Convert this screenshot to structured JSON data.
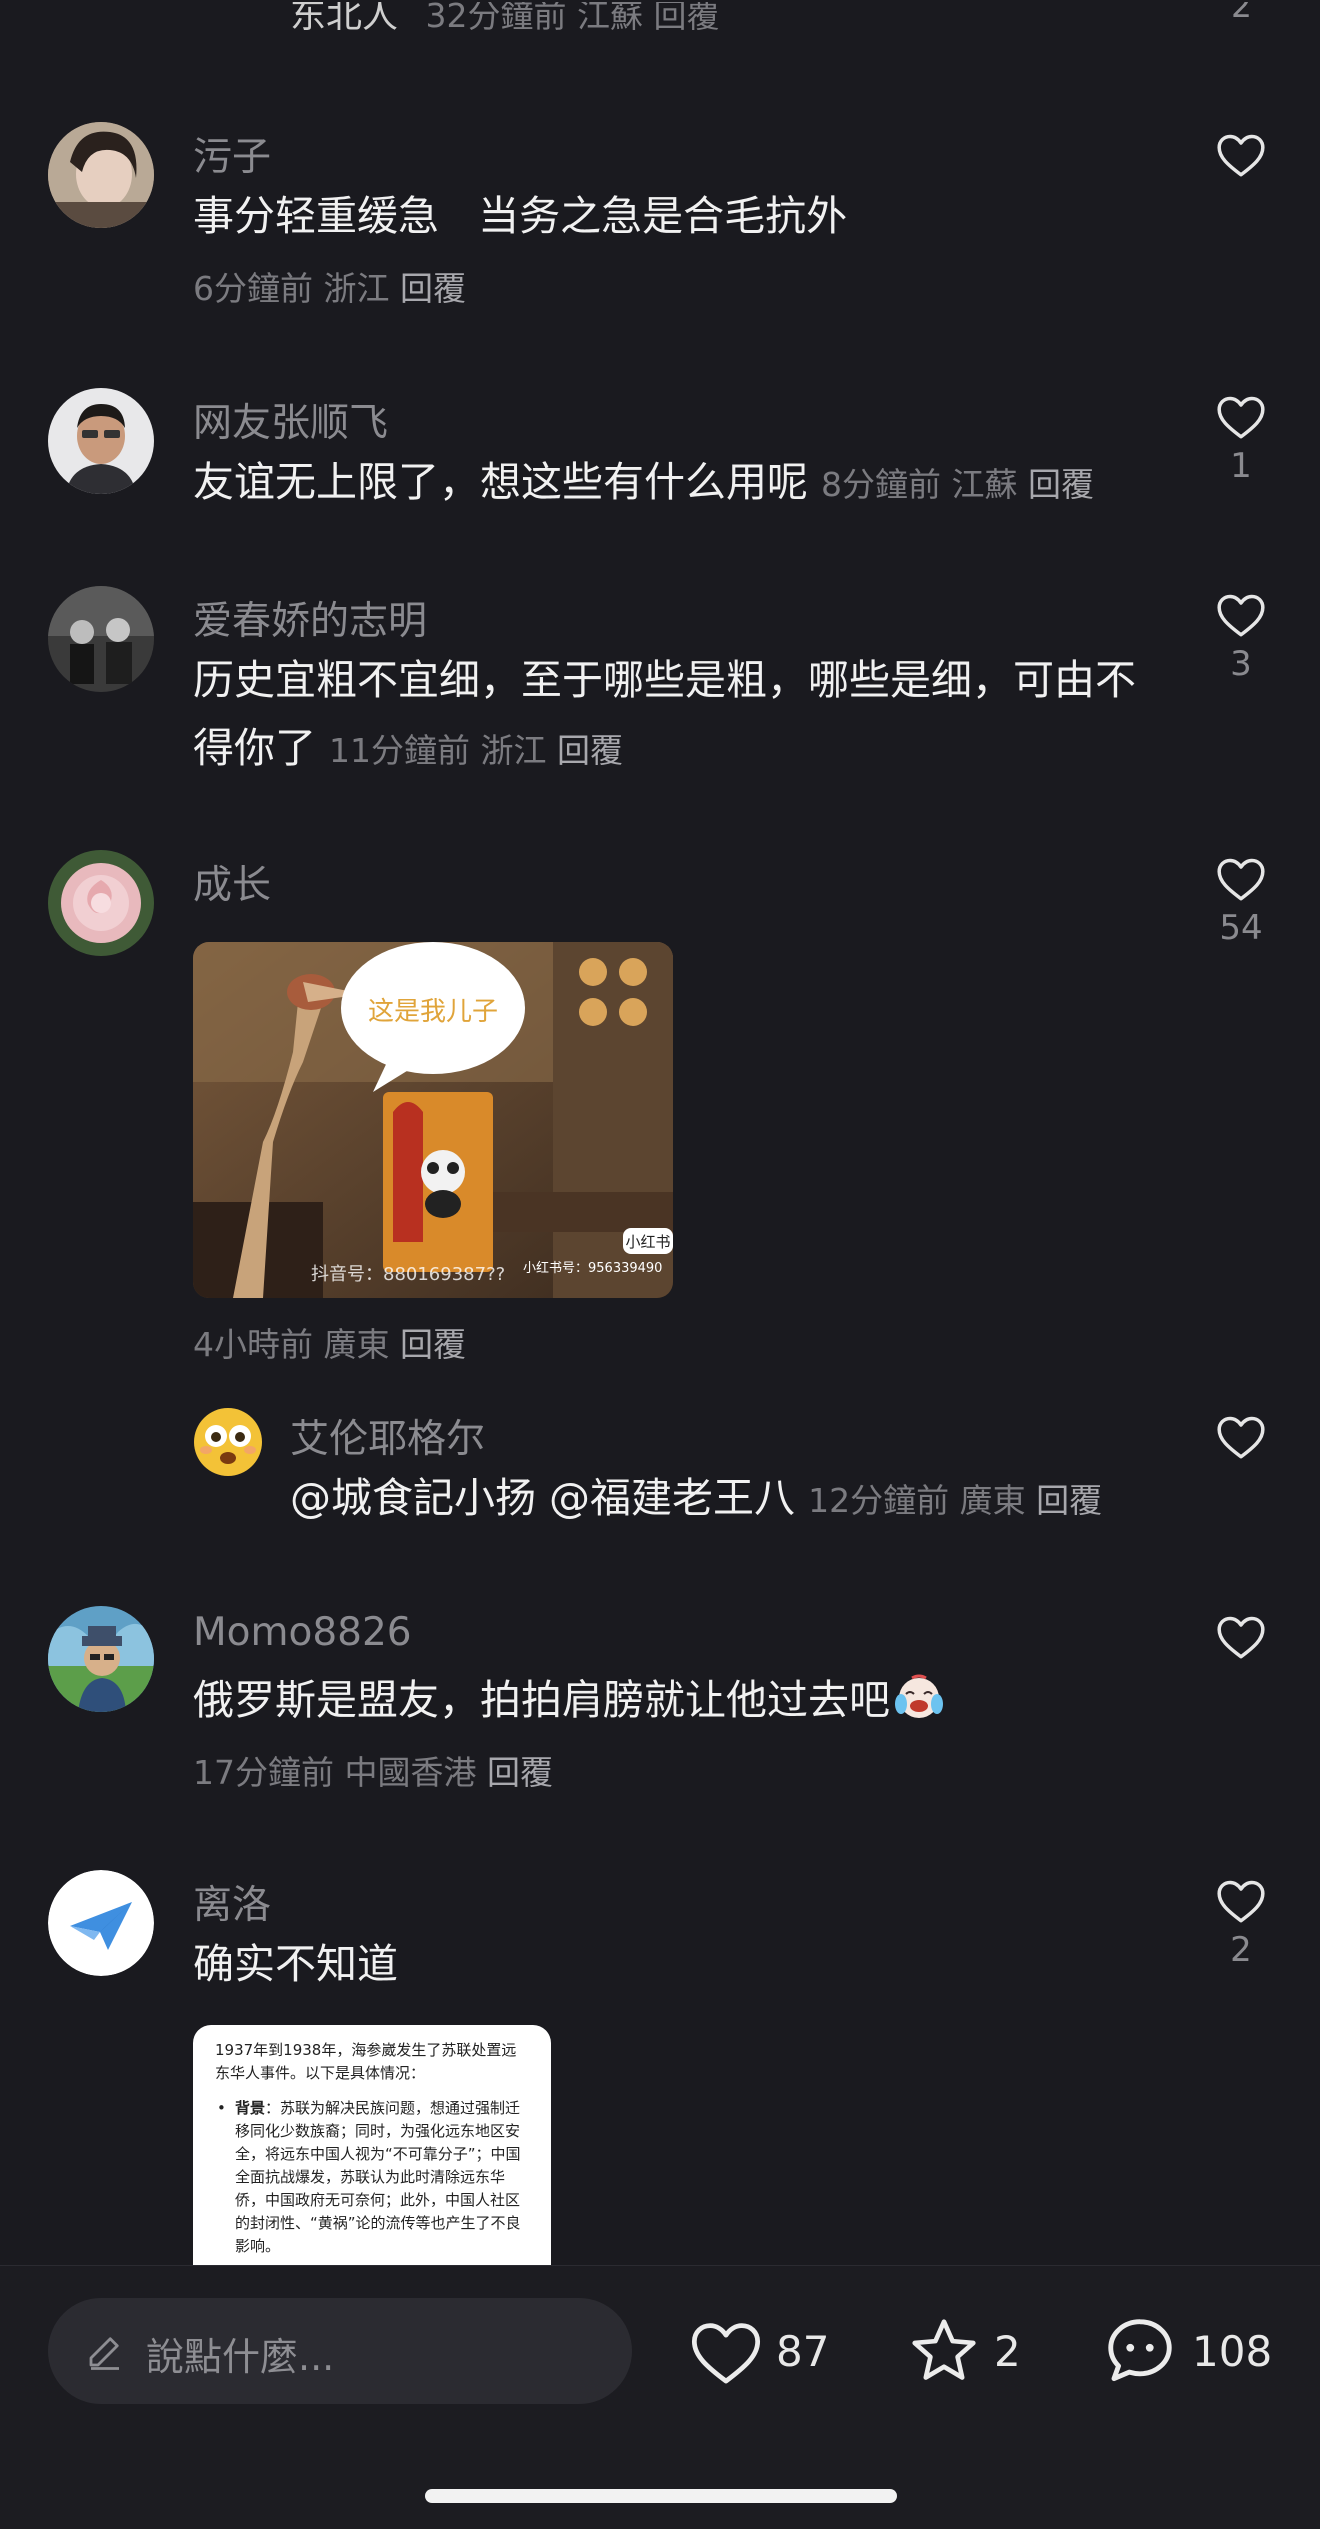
{
  "top_fragment": {
    "name": "东北人",
    "time": "32分鐘前",
    "region": "江蘇",
    "reply": "回覆",
    "likes": "2"
  },
  "comments": [
    {
      "name": "污子",
      "text": "事分轻重缓急   当务之急是合毛抗外",
      "time": "6分鐘前",
      "region": "浙江",
      "reply": "回覆",
      "likes": ""
    },
    {
      "name": "网友张顺飞",
      "text": "友谊无上限了，想这些有什么用呢",
      "time": "8分鐘前",
      "region": "江蘇",
      "reply": "回覆",
      "likes": "1"
    },
    {
      "name": "爱春娇的志明",
      "text": "历史宜粗不宜细，至于哪些是粗，哪些是细，可由不得你了",
      "time": "11分鐘前",
      "region": "浙江",
      "reply": "回覆",
      "likes": "3"
    },
    {
      "name": "成长",
      "text": "",
      "time": "4小時前",
      "region": "廣東",
      "reply": "回覆",
      "likes": "54",
      "image": {
        "bubble_text": "这是我儿子",
        "watermark_left": "抖音号：880169387??",
        "watermark_right": "小红书号：956339490",
        "badge": "小红书"
      }
    },
    {
      "name": "Momo8826",
      "text": "俄罗斯是盟友，拍拍肩膀就让他过去吧",
      "time": "17分鐘前",
      "region": "中國香港",
      "reply": "回覆",
      "likes": ""
    },
    {
      "name": "离洛",
      "text": "确实不知道",
      "likes": "2",
      "image": {
        "line1": "1937年到1938年，海参崴发生了苏联处置远东华人事件。以下是具体情况：",
        "bullet_label": "背景",
        "bullet_text": "：苏联为解决民族问题，想通过强制迁移同化少数族裔；同时，为强化远东地区安全，将远东中国人视为“不可靠分子”；中国全面抗战爆发，苏联认为此时清除远东华侨，中国政府无可奈何；此外，中国人社区的封闭性、“黄祸”论的流传等也产生了不良影响。"
      }
    }
  ],
  "reply": {
    "name": "艾伦耶格尔",
    "text": "@城食記小扬 @福建老王八",
    "time": "12分鐘前",
    "region": "廣東",
    "reply": "回覆",
    "likes": ""
  },
  "bottom_bar": {
    "placeholder": "說點什麼...",
    "likes": "87",
    "favorites": "2",
    "comments": "108"
  },
  "colors": {
    "background": "#1a1a1f",
    "text": "#f1f1f1",
    "muted": "#7b7b80",
    "bubble_text": "#e0a43a"
  },
  "icons": [
    "heart-icon",
    "pen-icon",
    "star-icon",
    "chat-bubble-icon"
  ]
}
